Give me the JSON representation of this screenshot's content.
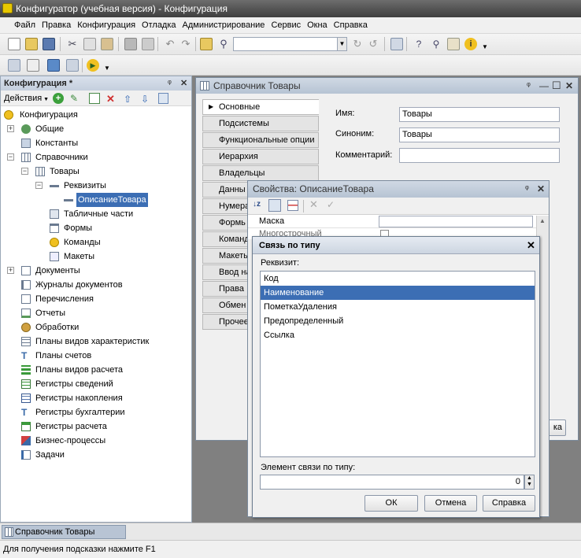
{
  "window": {
    "title": "Конфигуратор (учебная версия) - Конфигурация"
  },
  "menu": [
    "Файл",
    "Правка",
    "Конфигурация",
    "Отладка",
    "Администрирование",
    "Сервис",
    "Окна",
    "Справка"
  ],
  "left_panel": {
    "title": "Конфигурация *",
    "actions_label": "Действия",
    "tree": [
      {
        "label": "Конфигурация"
      },
      {
        "label": "Общие"
      },
      {
        "label": "Константы"
      },
      {
        "label": "Справочники"
      },
      {
        "label": "Товары"
      },
      {
        "label": "Реквизиты"
      },
      {
        "label": "ОписаниеТовара"
      },
      {
        "label": "Табличные части"
      },
      {
        "label": "Формы"
      },
      {
        "label": "Команды"
      },
      {
        "label": "Макеты"
      },
      {
        "label": "Документы"
      },
      {
        "label": "Журналы документов"
      },
      {
        "label": "Перечисления"
      },
      {
        "label": "Отчеты"
      },
      {
        "label": "Обработки"
      },
      {
        "label": "Планы видов характеристик"
      },
      {
        "label": "Планы счетов"
      },
      {
        "label": "Планы видов расчета"
      },
      {
        "label": "Регистры сведений"
      },
      {
        "label": "Регистры накопления"
      },
      {
        "label": "Регистры бухгалтерии"
      },
      {
        "label": "Регистры расчета"
      },
      {
        "label": "Бизнес-процессы"
      },
      {
        "label": "Задачи"
      }
    ]
  },
  "ref_window": {
    "title": "Справочник Товары",
    "tabs": [
      "Основные",
      "Подсистемы",
      "Функциональные опции",
      "Иерархия",
      "Владельцы",
      "Данны",
      "Нумера",
      "Формь",
      "Команд",
      "Макеть",
      "Ввод на",
      "Права",
      "Обмен",
      "Прочее"
    ],
    "fields": {
      "name_label": "Имя:",
      "name_value": "Товары",
      "synonym_label": "Синоним:",
      "synonym_value": "Товары",
      "comment_label": "Комментарий:",
      "comment_value": ""
    },
    "hidden_button_tail": "ка"
  },
  "prop_window": {
    "title": "Свойства: ОписаниеТовара",
    "row1": "Маска",
    "row2": "Многострочный"
  },
  "dialog": {
    "title": "Связь по типу",
    "list_label": "Реквизит:",
    "items": [
      "Код",
      "Наименование",
      "ПометкаУдаления",
      "Предопределенный",
      "Ссылка"
    ],
    "selected_index": 1,
    "link_label": "Элемент связи по типу:",
    "link_value": "0",
    "ok": "ОК",
    "cancel": "Отмена",
    "help": "Справка"
  },
  "taskbar": {
    "item": "Справочник Товары"
  },
  "status": "Для получения подсказки нажмите F1"
}
